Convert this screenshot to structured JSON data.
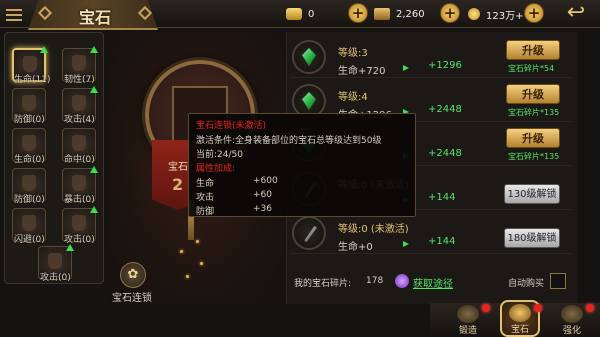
{
  "header": {
    "title": "宝石",
    "resources": [
      {
        "icon": "gold-ingot-icon",
        "value": "0"
      },
      {
        "icon": "bound-gold-icon",
        "value": "2,260"
      },
      {
        "icon": "coin-icon",
        "value": "123万+"
      }
    ],
    "back_icon": "back-arrow-icon"
  },
  "slots": [
    {
      "label": "生命(11)",
      "selected": true
    },
    {
      "label": "韧性(7)"
    },
    {
      "label": "防御(0)"
    },
    {
      "label": "攻击(4)"
    },
    {
      "label": "生命(0)"
    },
    {
      "label": "命中(0)"
    },
    {
      "label": "防御(0)"
    },
    {
      "label": "暴击(0)"
    },
    {
      "label": "闪避(0)"
    },
    {
      "label": "攻击(0)"
    },
    {
      "label": "攻击(0)"
    }
  ],
  "center": {
    "banner_text": "宝石",
    "banner_num": "2",
    "combo_label": "宝石连锁"
  },
  "gem_rows": [
    {
      "level": "等级:3",
      "stat": "生命+720",
      "gain": "+1296",
      "button": "升级",
      "frag": "宝石碎片*54"
    },
    {
      "level": "等级:4",
      "stat": "生命+1296",
      "gain": "+2448",
      "button": "升级",
      "frag": "宝石碎片*135"
    },
    {
      "level": "",
      "stat": "",
      "gain": "+2448",
      "button": "升级",
      "frag": "宝石碎片*135"
    },
    {
      "level": "等级:0 (未激活)",
      "stat": "",
      "gain": "+144",
      "button": "130级解锁",
      "frag": ""
    },
    {
      "level": "等级:0 (未激活)",
      "stat": "生命+0",
      "gain": "+144",
      "button": "180级解锁",
      "frag": ""
    }
  ],
  "footer": {
    "fragments_label": "我的宝石碎片:",
    "fragments_value": "178",
    "get_link": "获取途径",
    "auto_buy": "自动购买"
  },
  "tooltip": {
    "title": "宝石连锁(未激活)",
    "condition": "激活条件:全身装备部位的宝石总等级达到50级",
    "current": "当前:24/50",
    "bonus_title": "属性加成:",
    "stats": [
      {
        "name": "生命",
        "value": "+600"
      },
      {
        "name": "攻击",
        "value": "+60"
      },
      {
        "name": "防御",
        "value": "+36"
      }
    ]
  },
  "tabs": [
    {
      "label": "锻造"
    },
    {
      "label": "宝石",
      "active": true
    },
    {
      "label": "强化"
    }
  ],
  "colors": {
    "accent": "#e6c36a",
    "gain": "#55e565",
    "title_red": "#e6231c"
  }
}
